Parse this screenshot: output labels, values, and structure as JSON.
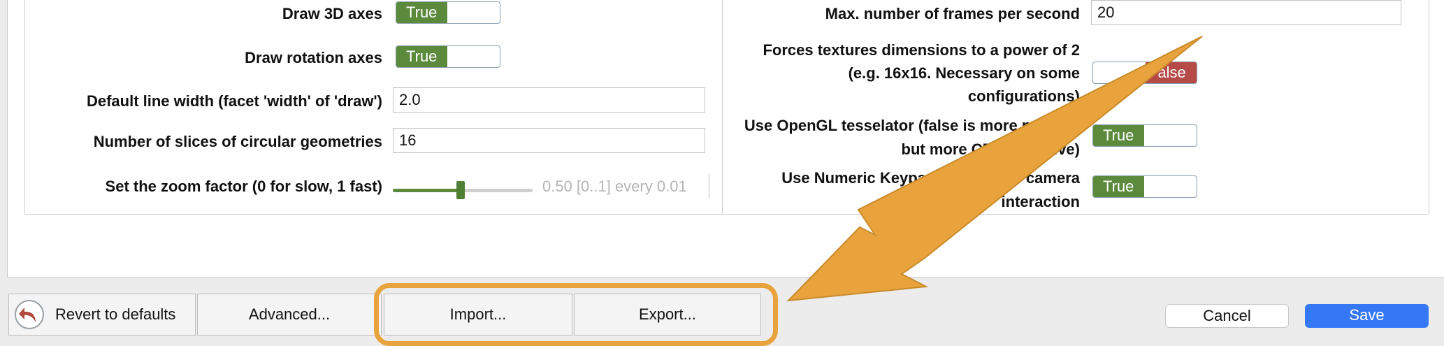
{
  "settings_left": {
    "draw_3d_axes": {
      "label": "Draw 3D axes",
      "value": "True"
    },
    "draw_rotation_axes": {
      "label": "Draw rotation axes",
      "value": "True"
    },
    "default_line_width": {
      "label": "Default line width (facet 'width' of 'draw')",
      "value": "2.0"
    },
    "number_of_slices": {
      "label": "Number of slices of circular geometries",
      "value": "16"
    },
    "zoom_factor": {
      "label": "Set the zoom factor (0 for slow, 1 fast)",
      "value": 0.5,
      "value_text": "0.50 [0..1] every 0.01"
    }
  },
  "settings_right": {
    "max_fps": {
      "label": "Max. number of frames per second",
      "value": "20"
    },
    "power_of_2": {
      "label_line1": "Forces textures dimensions to a power of 2",
      "label_line2": "(e.g. 16x16. Necessary on some",
      "label_line3": "configurations)",
      "value": "False"
    },
    "opengl_tesselator": {
      "label_line1": "Use OpenGL tesselator (false is more precise,",
      "label_line2": "but more CPU intensive)",
      "value": "True"
    },
    "numeric_keypad": {
      "label_line1": "Use Numeric Keypad (2,4,6,8) for camera",
      "label_line2": "interaction",
      "value": "True"
    }
  },
  "footer": {
    "revert_label": "Revert to defaults",
    "advanced_label": "Advanced...",
    "import_label": "Import...",
    "export_label": "Export...",
    "cancel_label": "Cancel",
    "save_label": "Save"
  },
  "colors": {
    "toggle_true": "#5b8a3c",
    "toggle_false": "#b54a48",
    "annotation": "#e9a33c",
    "save": "#3478f6"
  },
  "icons": {
    "revert": "undo-arrow-icon",
    "annotation": "callout-arrow-icon"
  }
}
